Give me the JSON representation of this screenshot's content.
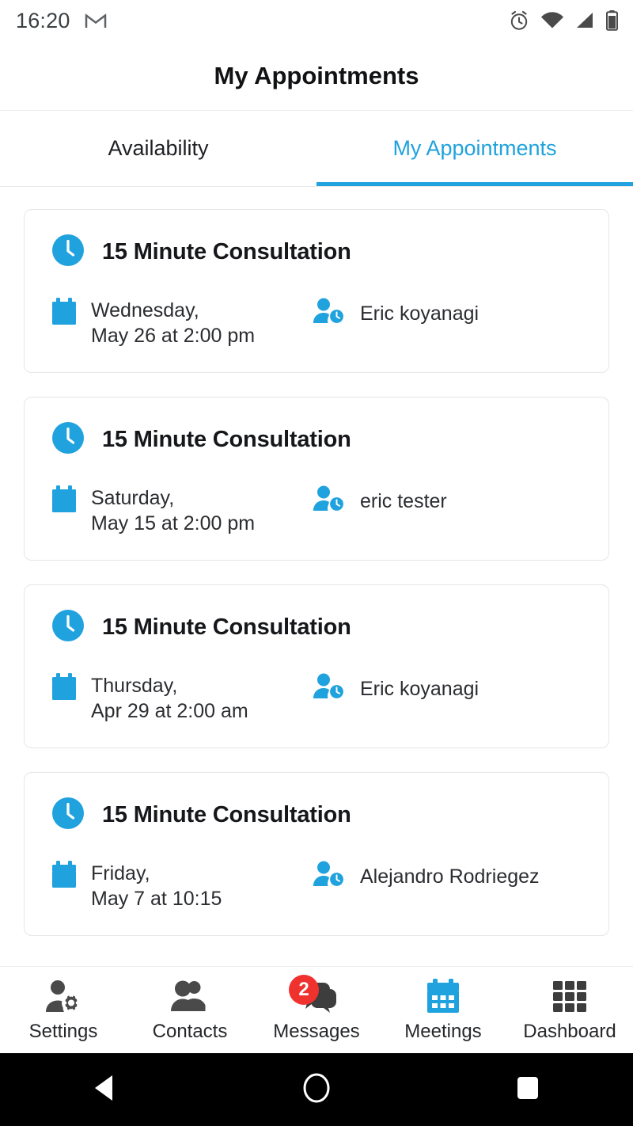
{
  "status_bar": {
    "time": "16:20",
    "icons": [
      "gmail-icon",
      "alarm-icon",
      "wifi-icon",
      "cellular-signal-icon",
      "battery-icon"
    ]
  },
  "app_bar": {
    "title": "My Appointments"
  },
  "tabs": [
    {
      "label": "Availability",
      "active": false
    },
    {
      "label": "My Appointments",
      "active": true
    }
  ],
  "appointments": [
    {
      "title": "15 Minute Consultation",
      "date_line1": "Wednesday,",
      "date_line2": "May 26 at 2:00 pm",
      "person": "Eric koyanagi"
    },
    {
      "title": "15 Minute Consultation",
      "date_line1": "Saturday,",
      "date_line2": "May 15 at 2:00 pm",
      "person": "eric tester"
    },
    {
      "title": "15 Minute Consultation",
      "date_line1": "Thursday,",
      "date_line2": "Apr 29 at 2:00 am",
      "person": "Eric koyanagi"
    },
    {
      "title": "15 Minute Consultation",
      "date_line1": "Friday,",
      "date_line2": "May 7 at 10:15",
      "person": "Alejandro Rodriegez"
    }
  ],
  "bottom_nav": [
    {
      "label": "Settings",
      "icon": "person-gear-icon",
      "active": false,
      "badge": null
    },
    {
      "label": "Contacts",
      "icon": "people-icon",
      "active": false,
      "badge": null
    },
    {
      "label": "Messages",
      "icon": "chat-bubbles-icon",
      "active": false,
      "badge": "2"
    },
    {
      "label": "Meetings",
      "icon": "calendar-icon",
      "active": true,
      "badge": null
    },
    {
      "label": "Dashboard",
      "icon": "grid-icon",
      "active": false,
      "badge": null
    }
  ],
  "system_nav": [
    {
      "name": "back-button",
      "icon": "triangle-left-icon"
    },
    {
      "name": "home-button",
      "icon": "circle-icon"
    },
    {
      "name": "recents-button",
      "icon": "square-icon"
    }
  ],
  "colors": {
    "accent": "#1fa2dd",
    "badge": "#f0322e",
    "text": "#1f2023",
    "icon_gray": "#4a4a4a",
    "card_border": "#e6e6e6"
  }
}
